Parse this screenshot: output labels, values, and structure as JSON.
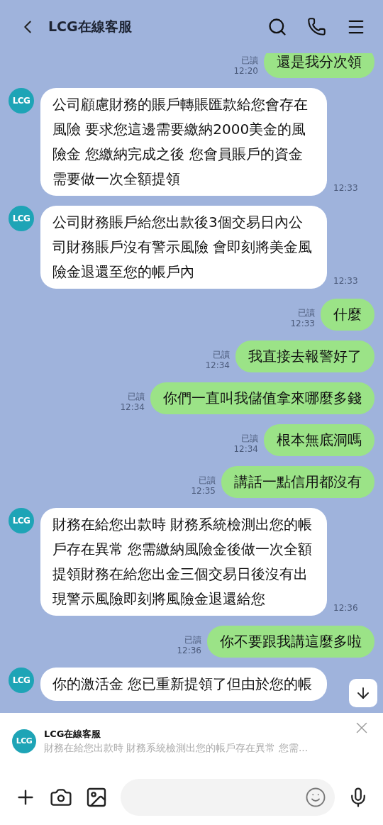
{
  "header": {
    "title": "LCG在線客服"
  },
  "messages": [
    {
      "kind": "outgoing",
      "text": "還是我分次領",
      "read": "已讀",
      "time": "12:20"
    },
    {
      "kind": "incoming",
      "avatar": "LCG",
      "text": "公司顧慮財務的賬戶轉賬匯款給您會存在風險 要求您這邊需要繳納2000美金的風險金  您繳納完成之後 您會員賬戶的資金需要做一次全額提領",
      "time": "12:33"
    },
    {
      "kind": "incoming",
      "avatar": "LCG",
      "text": "公司財務賬戶給您出款後3個交易日內公司財務賬戶沒有警示風險 會即刻將美金風險金退還至您的帳戶內",
      "time": "12:33"
    },
    {
      "kind": "outgoing",
      "text": "什麼",
      "read": "已讀",
      "time": "12:33"
    },
    {
      "kind": "outgoing",
      "text": "我直接去報警好了",
      "read": "已讀",
      "time": "12:34"
    },
    {
      "kind": "outgoing",
      "text": "你們一直叫我儲值拿來哪麼多錢",
      "read": "已讀",
      "time": "12:34"
    },
    {
      "kind": "outgoing",
      "text": "根本無底洞嗎",
      "read": "已讀",
      "time": "12:34"
    },
    {
      "kind": "outgoing",
      "text": "講話一點信用都沒有",
      "read": "已讀",
      "time": "12:35"
    },
    {
      "kind": "incoming",
      "avatar": "LCG",
      "text": "財務在給您出款時 財務系統檢測出您的帳戶存在異常 您需繳納風險金後做一次全額提領財務在給您出金三個交易日後沒有出現警示風險即刻將風險金退還給您",
      "time": "12:36"
    },
    {
      "kind": "outgoing",
      "text": "你不要跟我講這麼多啦",
      "read": "已讀",
      "time": "12:36"
    },
    {
      "kind": "incoming",
      "avatar": "LCG",
      "text": "你的激活金 您已重新提領了但由於您的帳"
    }
  ],
  "notification": {
    "avatar": "LCG",
    "title": "LCG在線客服",
    "preview": "財務在給您出款時 財務系統檢測出您的帳戶存在異常 您需..."
  }
}
